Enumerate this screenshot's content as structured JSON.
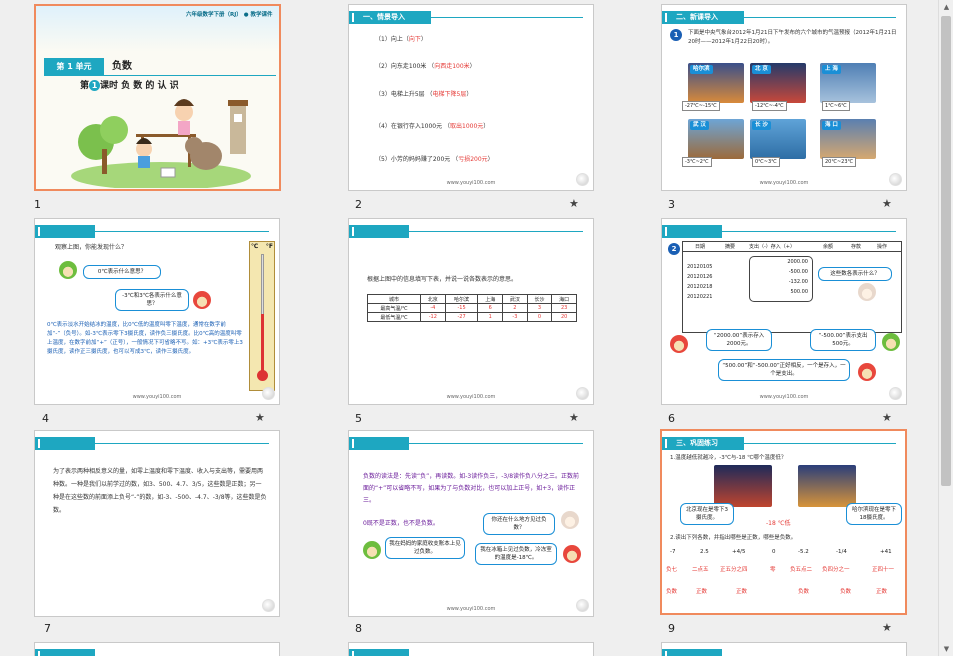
{
  "slides": [
    {
      "num": "1",
      "s1": {
        "header": "六年级数学下册（RJ）",
        "header2": "教学课件",
        "unit": "第 1 单元",
        "unit_title": "负数",
        "lesson_pre": "第",
        "lesson_num": "1",
        "lesson_post": "课时  负 数 的 认 识"
      }
    },
    {
      "num": "2",
      "s2": {
        "title": "一、情景导入",
        "items": [
          {
            "q": "（1）向上（",
            "a": "向下",
            "e": "）"
          },
          {
            "q": "（2）向东走100米  （",
            "a": "向西走100米",
            "e": "）"
          },
          {
            "q": "（3）电梯上升5层  （",
            "a": "电梯下降5层",
            "e": "）"
          },
          {
            "q": "（4）在银行存入1000元  （",
            "a": "取出1000元",
            "e": "）"
          },
          {
            "q": "（5）小芳的妈妈赚了200元  （",
            "a": "亏损200元",
            "e": "）"
          }
        ],
        "footer": "www.youyi100.com"
      }
    },
    {
      "num": "3",
      "s3": {
        "title": "二、新课导入",
        "badge": "1",
        "intro": "下面是中央气象台2012年1月21日下午发布的六个城市的气温预报（2012年1月21日20时——2012年1月22日20时）。",
        "cities": [
          {
            "name": "哈尔滨",
            "temp": "-27℃~-15℃"
          },
          {
            "name": "北 京",
            "temp": "-12℃~-4℃"
          },
          {
            "name": "上 海",
            "temp": "1℃~6℃"
          },
          {
            "name": "武 汉",
            "temp": "-3℃~2℃"
          },
          {
            "name": "长 沙",
            "temp": "0℃~3℃"
          },
          {
            "name": "海 口",
            "temp": "20℃~23℃"
          }
        ],
        "footer": "www.youyi100.com"
      }
    },
    {
      "num": "4",
      "s4": {
        "q": "观察上图，你能发现什么？",
        "b1": "0℃表示什么意思？",
        "b2": "-3℃和3℃各表示什么意思？",
        "para": "0℃表示淡水开始结冰的温度，比0℃低的温度叫零下温度，通常在数字前加“-”（负号）。如-3℃表示零下3摄氏度，读作负三摄氏度。比0℃高的温度叫零上温度，在数字前加“+”（正号），一般情况下可省略不写。如：+3℃表示零上3摄氏度，读作正三摄氏度，也可以写成3℃，读作三摄氏度。",
        "scale_c": "℃",
        "scale_f": "°F",
        "footer": "www.youyi100.com"
      }
    },
    {
      "num": "5",
      "s5": {
        "q": "根据上图中的信息填写下表，并说一说各数表示的意思。",
        "cols": [
          "城市",
          "北京",
          "哈尔滨",
          "上海",
          "武汉",
          "长沙",
          "海口"
        ],
        "rows": [
          {
            "label": "最高气温/℃",
            "vals": [
              "-4",
              "-15",
              "6",
              "2",
              "3",
              "23"
            ]
          },
          {
            "label": "最低气温/℃",
            "vals": [
              "-12",
              "-27",
              "1",
              "-3",
              "0",
              "20"
            ]
          }
        ],
        "footer": "www.youyi100.com"
      }
    },
    {
      "num": "6",
      "s6": {
        "badge": "2",
        "cols": [
          "日期",
          "摘要",
          "支出（-）存入（+）",
          "余额",
          "存款",
          "操作"
        ],
        "dates": [
          "20120105",
          "20120126",
          "20120218",
          "20120221"
        ],
        "amounts": [
          "2000.00",
          "-500.00",
          "-132.00",
          "500.00"
        ],
        "b1": "这些数各表示什么？",
        "b2": "“2000.00”表示存入2000元。",
        "b3": "“-500.00”表示支出500元。",
        "b4": "“500.00”和“-500.00”正好相反，一个是存入，一个是支出。",
        "footer": "www.youyi100.com"
      }
    },
    {
      "num": "7",
      "s7": {
        "para1": "为了表示两种相反意义的量，如零上温度和零下温度、收入与支出等，需要用两种数。一种是我们以前学过的数，如3、500、4.7、",
        "frac": "3/5",
        "para2": "，这些数是正数；另一种是在这些数的前面添上负号“-”的数，如-3、-500、-4.7、-",
        "frac2": "3/8",
        "para3": "等，这些数是负数。"
      }
    },
    {
      "num": "8",
      "s8": {
        "text": "负数的读法是：先读“负”，再读数。如-3读作负三，-",
        "frac": "3/8",
        "text2": "读作负八分之三。正数前面的“+”可以省略不写，如果为了与负数对比，也可以加上正号，如+3，读作正三。",
        "text3": "0既不是正数，也不是负数。",
        "b1": "你还在什么地方见过负数？",
        "b2": "我在妈妈的家庭收支账本上见过负数。",
        "b3": "我在冰箱上见过负数，冷冻室的温度是-18℃。",
        "footer": "www.youyi100.com"
      }
    },
    {
      "num": "9",
      "s9": {
        "title": "三、巩固练习",
        "q1": "1.温度越低就越冷，-3℃与-18 ℃哪个温度低？",
        "b1": "北京现在是零下3摄氏度。",
        "b2": "哈尔滨现在是零下18摄氏度。",
        "ans1": "-18 ℃低",
        "q2": "2.读出下列各数，并指出哪些是正数，哪些是负数。",
        "nums": [
          "-7",
          "2.5",
          "+4/5",
          "0",
          "-5.2",
          "-1/4",
          "+41"
        ],
        "reads": [
          "负七",
          "二点五",
          "正五分之四",
          "零",
          "负五点二",
          "负四分之一",
          "正四十一"
        ],
        "kinds": [
          "负数",
          "正数",
          "正数",
          "",
          "负数",
          "负数",
          "正数"
        ]
      }
    }
  ],
  "star": "★"
}
